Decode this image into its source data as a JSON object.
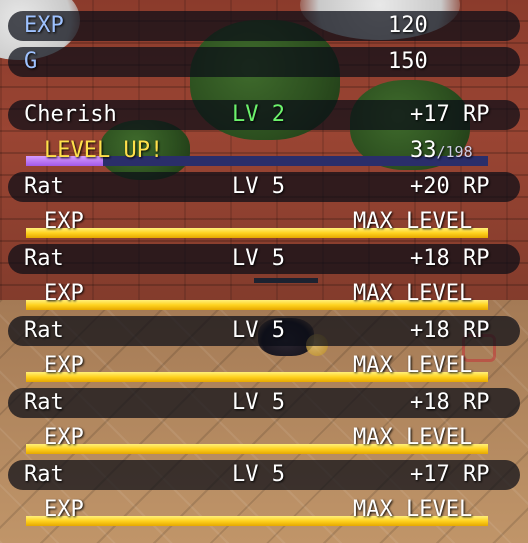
{
  "rewards": {
    "exp_label": "EXP",
    "exp_value": "120",
    "gold_label": "G",
    "gold_value": "150"
  },
  "party": [
    {
      "name": "Cherish",
      "level": "LV 2",
      "rp": "+17 RP",
      "status": "LEVEL UP!",
      "progress_current": "33",
      "progress_total": "/198",
      "progress_fraction": 0.167
    },
    {
      "name": "Rat",
      "level": "LV 5",
      "rp": "+20 RP",
      "status": "EXP",
      "max": "MAX LEVEL",
      "progress_fraction": 1.0
    },
    {
      "name": "Rat",
      "level": "LV 5",
      "rp": "+18 RP",
      "status": "EXP",
      "max": "MAX LEVEL",
      "progress_fraction": 1.0
    },
    {
      "name": "Rat",
      "level": "LV 5",
      "rp": "+18 RP",
      "status": "EXP",
      "max": "MAX LEVEL",
      "progress_fraction": 1.0
    },
    {
      "name": "Rat",
      "level": "LV 5",
      "rp": "+18 RP",
      "status": "EXP",
      "max": "MAX LEVEL",
      "progress_fraction": 1.0
    },
    {
      "name": "Rat",
      "level": "LV 5",
      "rp": "+17 RP",
      "status": "EXP",
      "max": "MAX LEVEL",
      "progress_fraction": 1.0
    }
  ],
  "colors": {
    "exp_label": "#9ec2ff",
    "level_up_lv": "#6cf26c",
    "level_up_text": "#ffe04a",
    "exp_bar": "#ffd21f",
    "levelup_bar": "#a459e8",
    "bar_track": "#2a2e6a"
  }
}
